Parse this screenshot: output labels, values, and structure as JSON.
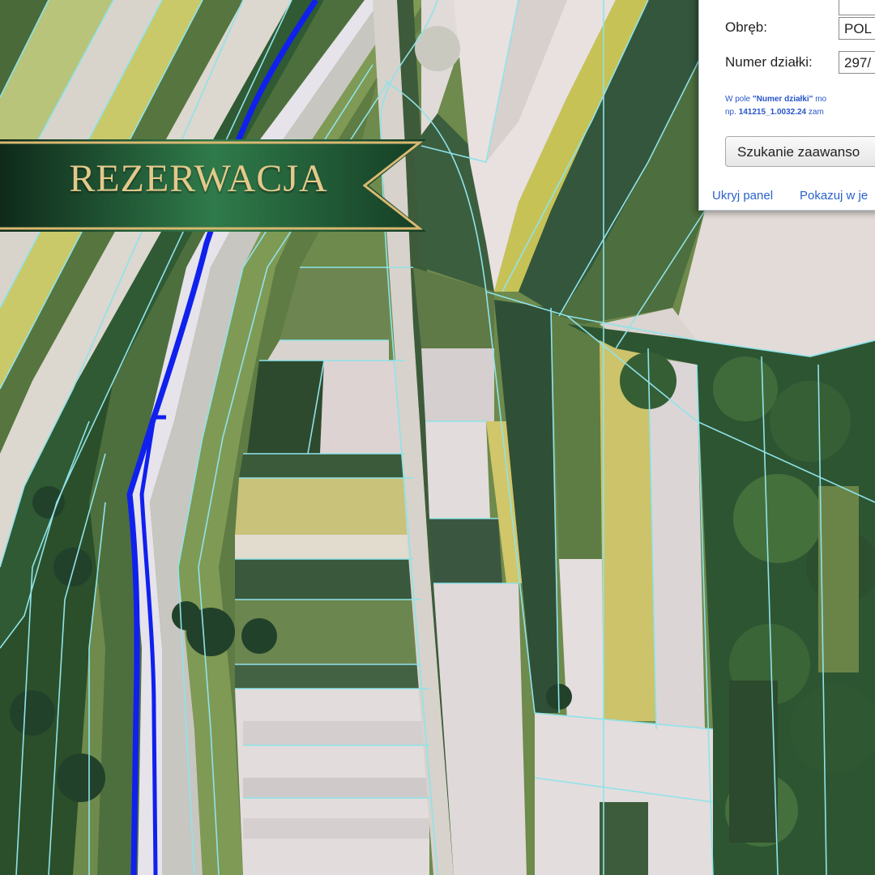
{
  "banner": {
    "label": "REZERWACJA"
  },
  "search_panel": {
    "obreb_label": "Obręb:",
    "obreb_value": "POL",
    "numer_label": "Numer działki:",
    "numer_value": "297/",
    "hint_line1_prefix": "W pole",
    "hint_line1_field": "\"Numer działki\"",
    "hint_line1_suffix": "mo",
    "hint_line2_prefix": "np.",
    "hint_line2_example": "141215_1.0032.24",
    "hint_line2_suffix": "zam",
    "advanced_button": "Szukanie zaawanso",
    "hide_panel_link": "Ukryj panel",
    "show_link": "Pokazuj w je"
  },
  "colors": {
    "parcel_border": "#8fe3ea",
    "highlight_border": "#1020ee",
    "banner_green": "#1f5a35",
    "banner_gold": "#d9b870"
  }
}
